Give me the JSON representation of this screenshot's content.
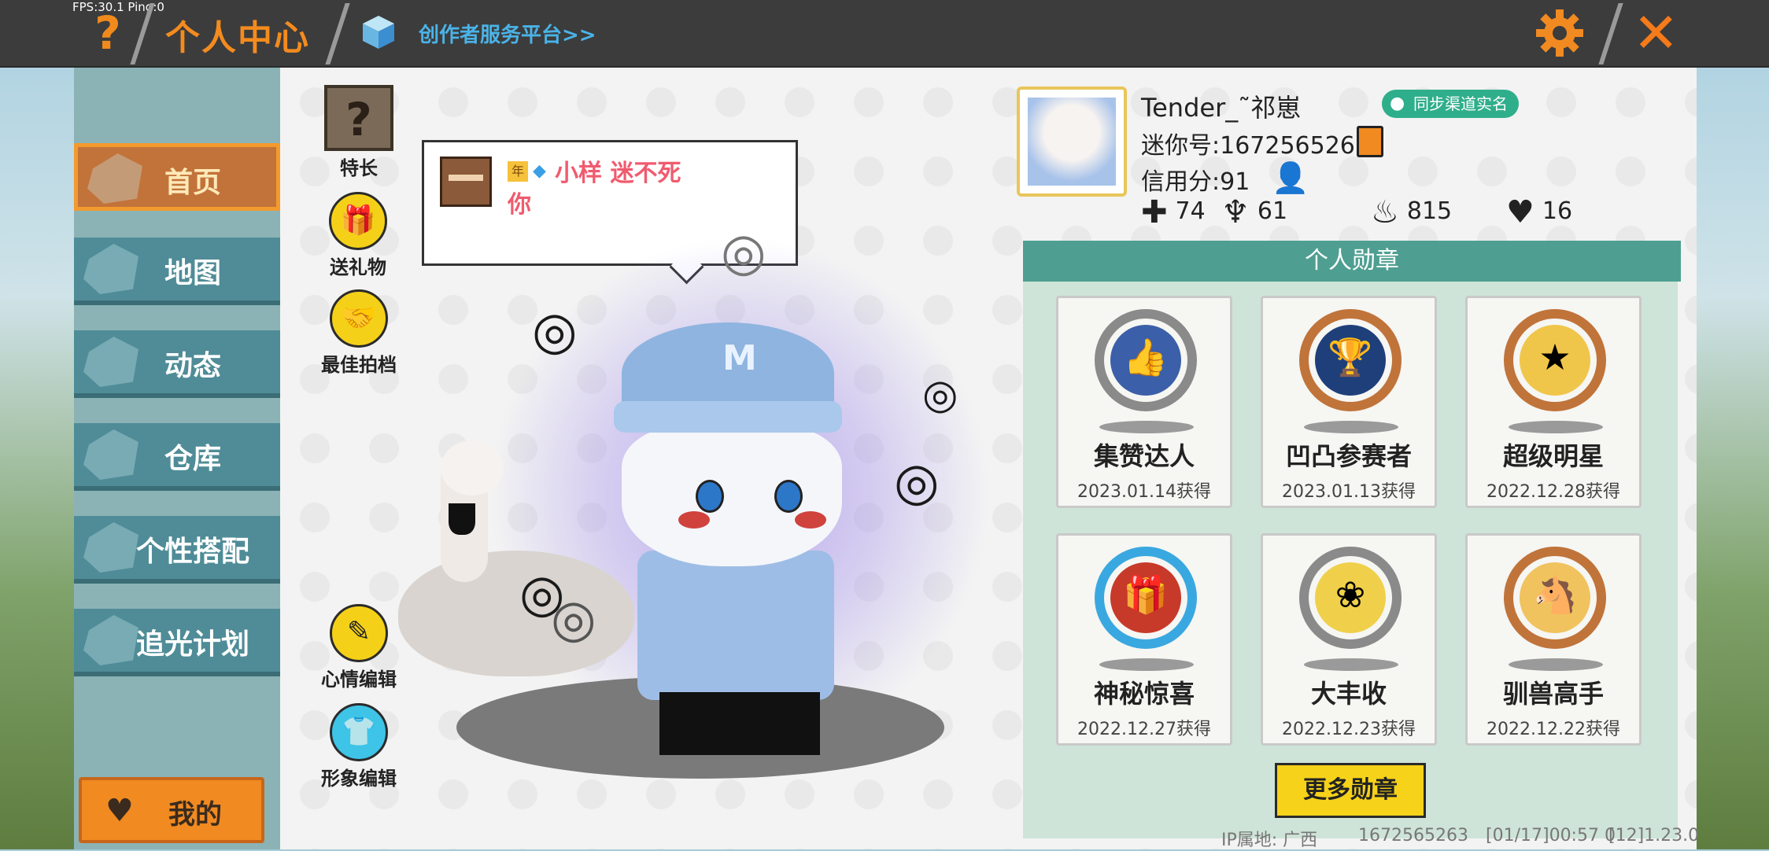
{
  "topbar": {
    "fps": "FPS:30.1  Ping:0",
    "help_icon": "?",
    "title": "个人中心",
    "creator_link": "创作者服务平台>>",
    "close_icon": "✕"
  },
  "nav": {
    "items": [
      {
        "label": "首页",
        "active": true
      },
      {
        "label": "地图",
        "active": false
      },
      {
        "label": "动态",
        "active": false
      },
      {
        "label": "仓库",
        "active": false
      },
      {
        "label": "个性搭配",
        "active": false
      },
      {
        "label": "追光计划",
        "active": false
      }
    ],
    "my_button": "我的"
  },
  "side_buttons": {
    "skill": "特长",
    "gift": "送礼物",
    "partner": "最佳拍档",
    "mood": "心情编辑",
    "appearance": "形象编辑"
  },
  "bubble": {
    "year_badge": "年",
    "message": "小样 迷不死你"
  },
  "profile": {
    "username": "Tender_˜祁崽",
    "sync_realname": "同步渠道实名",
    "mini_id": "迷你号:1672565263",
    "credit": "信用分:91",
    "stats": {
      "follow": "74",
      "fans": "61",
      "heat": "815",
      "likes": "16"
    }
  },
  "badges": {
    "header": "个人勋章",
    "items": [
      {
        "name": "集赞达人",
        "date": "2023.01.14获得",
        "icon": "thumbs-up-medal-icon",
        "color": "#3b5fa8",
        "ring": "#8a8a8a"
      },
      {
        "name": "凹凸参赛者",
        "date": "2023.01.13获得",
        "icon": "trophy-medal-icon",
        "color": "#1f3f7a",
        "ring": "#c0743a"
      },
      {
        "name": "超级明星",
        "date": "2022.12.28获得",
        "icon": "star-bear-medal-icon",
        "color": "#f0c64a",
        "ring": "#c0743a"
      },
      {
        "name": "神秘惊喜",
        "date": "2022.12.27获得",
        "icon": "gift-box-medal-icon",
        "color": "#c73a2a",
        "ring": "#3aa8e0"
      },
      {
        "name": "大丰收",
        "date": "2022.12.23获得",
        "icon": "harvest-medal-icon",
        "color": "#f0d04a",
        "ring": "#8a8a8a"
      },
      {
        "name": "驯兽高手",
        "date": "2022.12.22获得",
        "icon": "monkey-horse-medal-icon",
        "color": "#f1c35e",
        "ring": "#c0743a"
      }
    ],
    "more_button": "更多勋章"
  },
  "footer": {
    "ip": "IP属地: 广西",
    "id": "1672565263",
    "time": "[01/17]00:57 0",
    "version": "[12]1.23.0"
  },
  "colors": {
    "accent_orange": "#f48b1e",
    "nav_teal": "#4f8c97",
    "badge_header": "#4e9f91"
  }
}
